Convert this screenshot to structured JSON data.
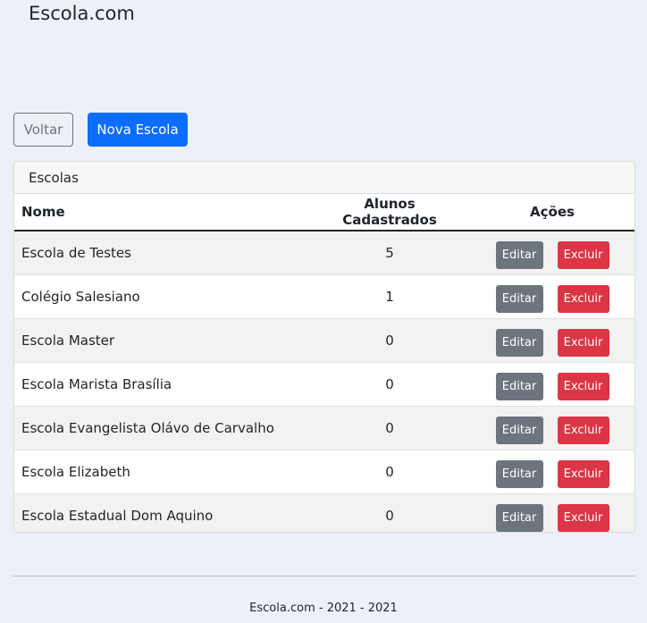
{
  "brand": "Escola.com",
  "actions": {
    "back_label": "Voltar",
    "new_label": "Nova Escola"
  },
  "card": {
    "title": "Escolas",
    "headers": {
      "name": "Nome",
      "students": "Alunos Cadastrados",
      "actions": "Ações"
    },
    "rows": [
      {
        "name": "Escola de Testes",
        "students": "5"
      },
      {
        "name": "Colégio Salesiano",
        "students": "1"
      },
      {
        "name": "Escola Master",
        "students": "0"
      },
      {
        "name": "Escola Marista Brasília",
        "students": "0"
      },
      {
        "name": "Escola Evangelista Olávo de Carvalho",
        "students": "0"
      },
      {
        "name": "Escola Elizabeth",
        "students": "0"
      },
      {
        "name": "Escola Estadual Dom Aquino",
        "students": "0"
      }
    ],
    "edit_label": "Editar",
    "delete_label": "Excluir"
  },
  "footer": "Escola.com - 2021 - 2021",
  "colors": {
    "primary": "#0d6efd",
    "secondary": "#6c757d",
    "danger": "#dc3545",
    "background": "#edf0f7"
  }
}
